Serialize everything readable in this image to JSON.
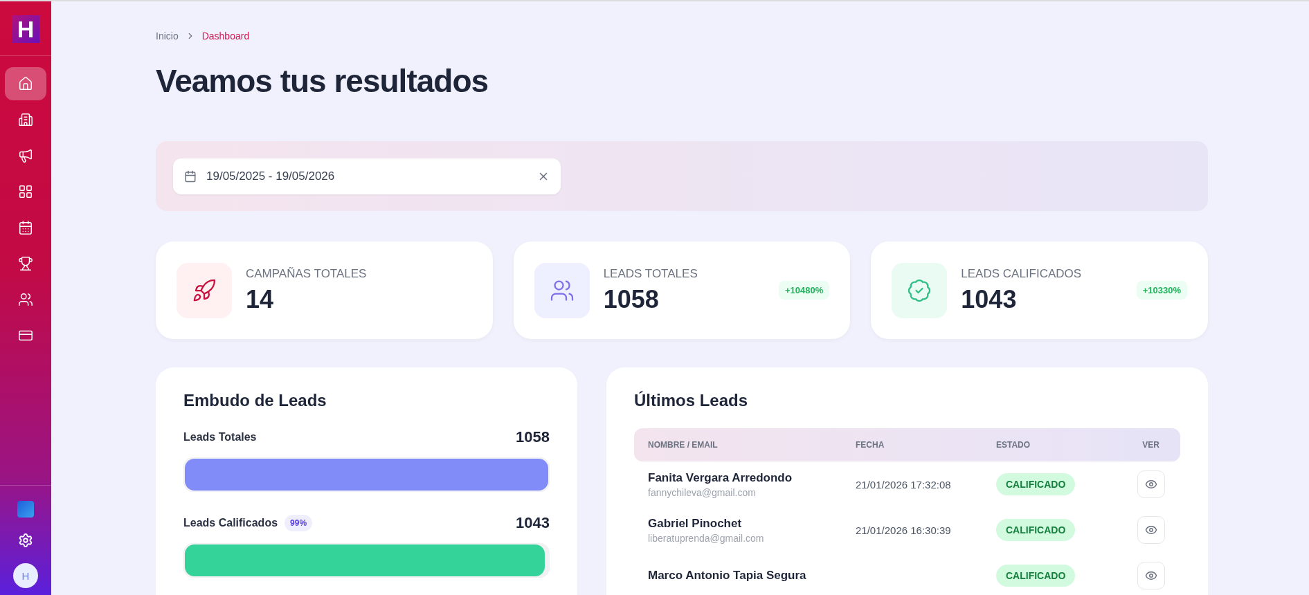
{
  "sidebar": {
    "logo": "H",
    "items": [
      {
        "selected": true
      },
      {
        "selected": false
      },
      {
        "selected": false
      },
      {
        "selected": false
      },
      {
        "selected": false
      },
      {
        "selected": false
      },
      {
        "selected": false
      },
      {
        "selected": false
      }
    ],
    "avatar": "H"
  },
  "breadcrumb": [
    "Inicio",
    "Dashboard"
  ],
  "title": "Veamos tus resultados",
  "date_filter": {
    "value": "19/05/2025 - 19/05/2026"
  },
  "stats": [
    {
      "label": "CAMPAÑAS TOTALES",
      "value": "14",
      "kind": "campaigns"
    },
    {
      "label": "LEADS TOTALES",
      "value": "1058",
      "badge": "+10480%",
      "kind": "leads"
    },
    {
      "label": "LEADS CALIFICADOS",
      "value": "1043",
      "badge": "+10330%",
      "kind": "qualified"
    }
  ],
  "funnel": {
    "title": "Embudo de Leads",
    "stages": [
      {
        "label": "Leads Totales",
        "value": "1058",
        "level": 1,
        "color": "#818cf8"
      },
      {
        "label": "Leads Calificados",
        "badge": "99%",
        "value": "1043",
        "level": 0.99,
        "color": "#34d399"
      }
    ]
  },
  "latest_leads": {
    "title": "Últimos Leads",
    "columns": [
      "NOMBRE / EMAIL",
      "FECHA",
      "ESTADO",
      "VER"
    ],
    "rows": [
      {
        "name": "Fanita Vergara Arredondo",
        "email": "fannychileva@gmail.com",
        "date": "21/01/2026 17:32:08",
        "status": "CALIFICADO"
      },
      {
        "name": "Gabriel Pinochet",
        "email": "liberatuprenda@gmail.com",
        "date": "21/01/2026 16:30:39",
        "status": "CALIFICADO"
      },
      {
        "name": "Marco Antonio Tapia Segura",
        "status": "CALIFICADO"
      }
    ]
  }
}
